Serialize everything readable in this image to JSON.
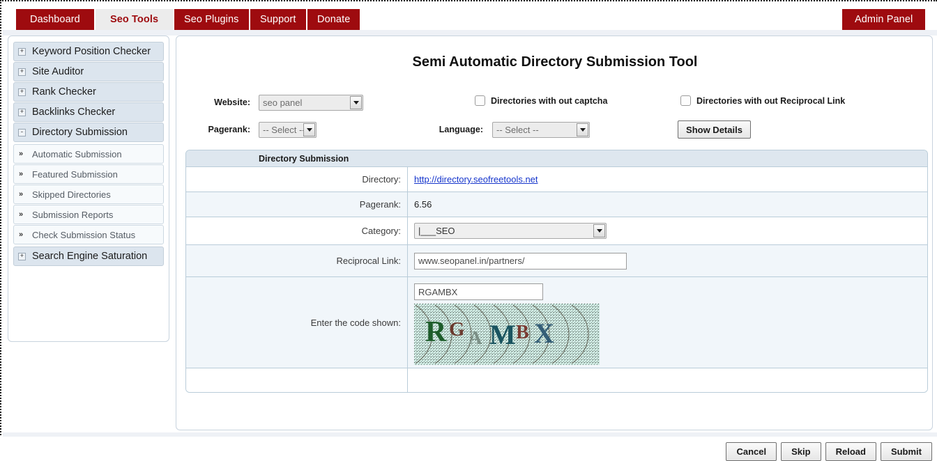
{
  "nav": {
    "tabs": [
      {
        "label": "Dashboard",
        "active": false
      },
      {
        "label": "Seo Tools",
        "active": true
      },
      {
        "label": "Seo Plugins",
        "active": false
      },
      {
        "label": "Support",
        "active": false
      },
      {
        "label": "Donate",
        "active": false
      }
    ],
    "admin_label": "Admin Panel",
    "accent_color": "#9e0b0f"
  },
  "sidebar": {
    "groups": [
      {
        "label": "Keyword Position Checker",
        "state": "+"
      },
      {
        "label": "Site Auditor",
        "state": "+"
      },
      {
        "label": "Rank Checker",
        "state": "+"
      },
      {
        "label": "Backlinks Checker",
        "state": "+"
      },
      {
        "label": "Directory Submission",
        "state": "-"
      }
    ],
    "sub_items": [
      {
        "label": "Automatic Submission"
      },
      {
        "label": "Featured Submission"
      },
      {
        "label": "Skipped Directories"
      },
      {
        "label": "Submission Reports"
      },
      {
        "label": "Check Submission Status"
      }
    ],
    "last_group": {
      "label": "Search Engine Saturation",
      "state": "+"
    }
  },
  "main": {
    "title": "Semi Automatic Directory Submission Tool",
    "filters": {
      "website_label": "Website:",
      "website_value": "seo panel",
      "pagerank_label": "Pagerank:",
      "pagerank_value": "-- Select --",
      "language_label": "Language:",
      "language_value": "-- Select --",
      "checkbox_no_captcha": "Directories with out captcha",
      "checkbox_no_reciprocal": "Directories with out Reciprocal Link",
      "show_details_label": "Show Details"
    },
    "table": {
      "header": "Directory Submission",
      "rows": [
        {
          "label": "Directory:",
          "value": "http://directory.seofreetools.net",
          "kind": "link"
        },
        {
          "label": "Pagerank:",
          "value": "6.56",
          "kind": "text"
        },
        {
          "label": "Category:",
          "value": "|___SEO",
          "kind": "select"
        },
        {
          "label": "Reciprocal Link:",
          "value": "www.seopanel.in/partners/",
          "kind": "input"
        },
        {
          "label": "Enter the code shown:",
          "value": "RGAMBX",
          "kind": "captcha"
        },
        {
          "label": "",
          "value": "",
          "kind": "blank"
        }
      ]
    },
    "captcha": {
      "input_value": "RGAMBX",
      "image_text": "RGAMBX",
      "letters": [
        {
          "ch": "R",
          "color": "#1d5c2a"
        },
        {
          "ch": "G",
          "color": "#6b3a2e"
        },
        {
          "ch": "A",
          "color": "#7b8f86"
        },
        {
          "ch": "M",
          "color": "#1a5460"
        },
        {
          "ch": "B",
          "color": "#7a3a32"
        },
        {
          "ch": "X",
          "color": "#2a5571"
        }
      ],
      "background_color": "#cfeae2"
    },
    "actions": [
      {
        "label": "Cancel"
      },
      {
        "label": "Skip"
      },
      {
        "label": "Reload"
      },
      {
        "label": "Submit"
      }
    ]
  }
}
